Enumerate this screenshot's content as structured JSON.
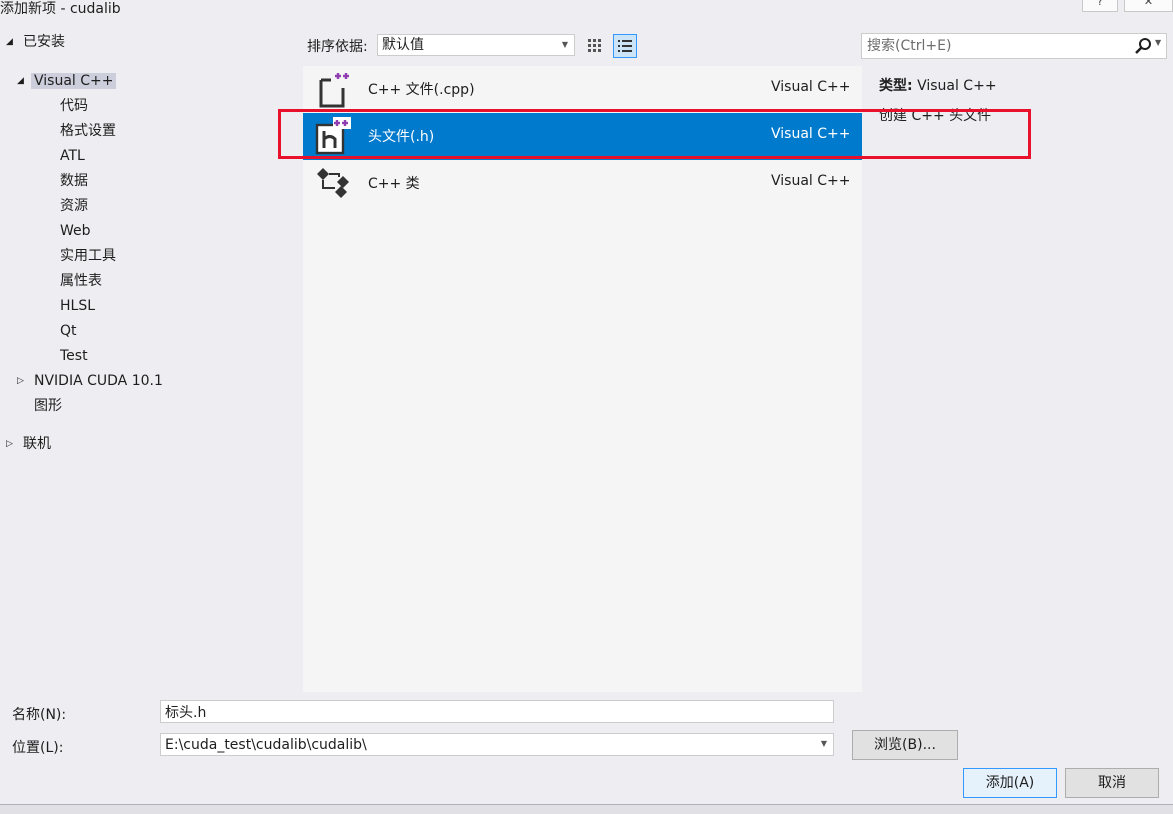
{
  "window": {
    "title": "添加新项 - cudalib",
    "help_label": "?",
    "close_label": "✕"
  },
  "tree": {
    "installed": "已安装",
    "visual_cpp": "Visual C++",
    "children": [
      "代码",
      "格式设置",
      "ATL",
      "数据",
      "资源",
      "Web",
      "实用工具",
      "属性表",
      "HLSL",
      "Qt",
      "Test"
    ],
    "nvidia_cuda": "NVIDIA CUDA 10.1",
    "graphics": "图形",
    "online": "联机"
  },
  "sortbar": {
    "label": "排序依据:",
    "value": "默认值"
  },
  "search": {
    "placeholder": "搜索(Ctrl+E)"
  },
  "templates": [
    {
      "name": "C++ 文件(.cpp)",
      "type": "Visual C++",
      "icon": "cpp-file-icon",
      "selected": false
    },
    {
      "name": "头文件(.h)",
      "type": "Visual C++",
      "icon": "header-file-icon",
      "selected": true
    },
    {
      "name": "C++ 类",
      "type": "Visual C++",
      "icon": "cpp-class-icon",
      "selected": false
    }
  ],
  "details": {
    "type_label": "类型:",
    "type_value": "Visual C++",
    "description": "创建 C++ 头文件"
  },
  "form": {
    "name_label": "名称(N):",
    "name_value": "标头.h",
    "location_label": "位置(L):",
    "location_value": "E:\\cuda_test\\cudalib\\cudalib\\",
    "browse_label": "浏览(B)...",
    "add_label": "添加(A)",
    "cancel_label": "取消"
  },
  "colors": {
    "accent": "#007acc",
    "highlight_box": "#e8102a",
    "tree_selected": "#cccedb"
  }
}
